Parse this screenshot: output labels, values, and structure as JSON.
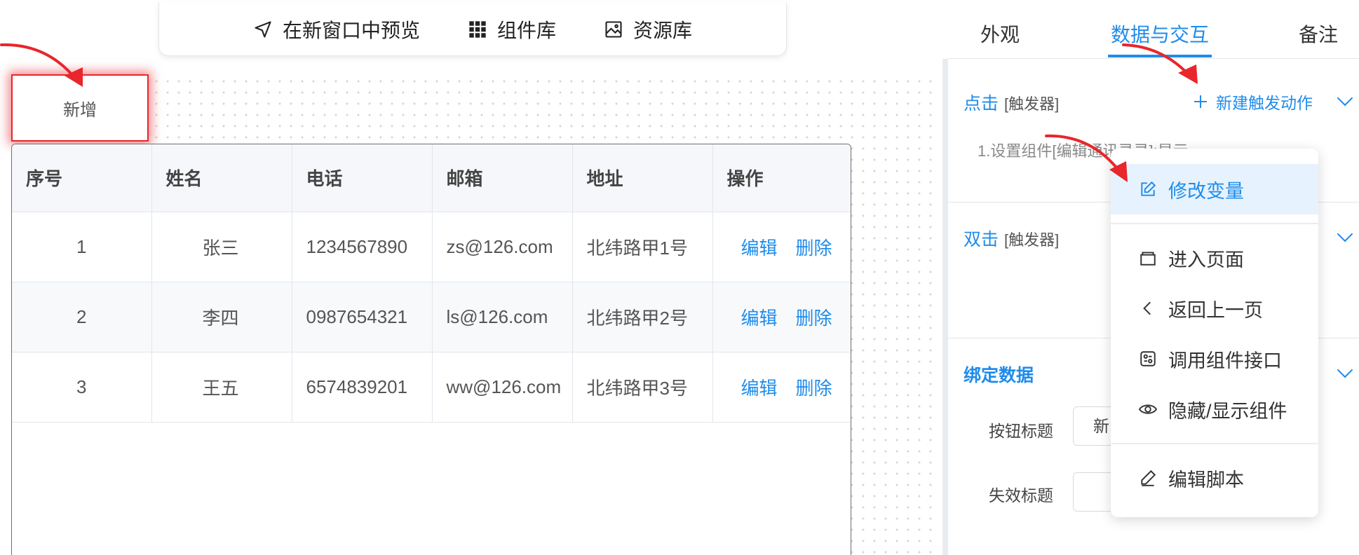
{
  "toolbar": {
    "preview_label": "在新窗口中预览",
    "components_label": "组件库",
    "assets_label": "资源库"
  },
  "canvas": {
    "add_button_label": "新增"
  },
  "table": {
    "columns": [
      "序号",
      "姓名",
      "电话",
      "邮箱",
      "地址",
      "操作"
    ],
    "rows": [
      {
        "index": "1",
        "name": "张三",
        "phone": "1234567890",
        "email": "zs@126.com",
        "address": "北纬路甲1号",
        "edit": "编辑",
        "delete": "删除"
      },
      {
        "index": "2",
        "name": "李四",
        "phone": "0987654321",
        "email": "ls@126.com",
        "address": "北纬路甲2号",
        "edit": "编辑",
        "delete": "删除"
      },
      {
        "index": "3",
        "name": "王五",
        "phone": "6574839201",
        "email": "ww@126.com",
        "address": "北纬路甲3号",
        "edit": "编辑",
        "delete": "删除"
      }
    ]
  },
  "panel": {
    "tabs": [
      "外观",
      "数据与交互",
      "备注"
    ],
    "active_tab": "数据与交互",
    "click_section": {
      "title": "点击",
      "tag": "[触发器]",
      "new_action": "新建触发动作",
      "step": "1.设置组件[编辑通讯录录]:显示"
    },
    "dblclick_section": {
      "title": "双击",
      "tag": "[触发器]"
    },
    "bind_section": {
      "title": "绑定数据",
      "button_title_label": "按钮标题",
      "button_title_value": "新",
      "disabled_title_label": "失效标题"
    }
  },
  "menu": {
    "items": [
      {
        "label": "修改变量",
        "icon": "edit-icon",
        "highlighted": true
      },
      {
        "label": "进入页面",
        "icon": "page-icon"
      },
      {
        "label": "返回上一页",
        "icon": "back-icon"
      },
      {
        "label": "调用组件接口",
        "icon": "api-icon"
      },
      {
        "label": "隐藏/显示组件",
        "icon": "eye-icon"
      },
      {
        "label": "编辑脚本",
        "icon": "script-icon"
      }
    ]
  },
  "colors": {
    "accent": "#1f8ceb",
    "highlight_red": "#e8262b",
    "menu_highlight_bg": "#e6f2fd"
  }
}
